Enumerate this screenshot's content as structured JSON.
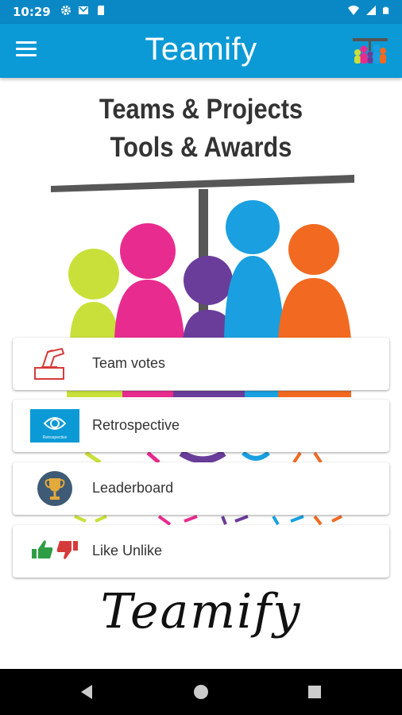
{
  "status_bar": {
    "time": "10:29",
    "icons_left": [
      "gear-icon",
      "gmail-icon",
      "sd-card-icon"
    ],
    "icons_right": [
      "wifi-icon",
      "signal-icon",
      "battery-icon"
    ]
  },
  "app_bar": {
    "title": "Teamify",
    "menu_icon": "hamburger-menu-icon",
    "logo_icon": "teamify-logo-icon"
  },
  "headline": {
    "line1": "Teams & Projects",
    "line2": "Tools & Awards"
  },
  "illustration": {
    "colors": [
      "#c9e03a",
      "#e82b8e",
      "#6a3d9a",
      "#1aa0e0",
      "#f26a21"
    ]
  },
  "menu": [
    {
      "label": "Team votes",
      "icon": "ballot-vote-icon"
    },
    {
      "label": "Retrospective",
      "icon": "retrospective-eye-icon",
      "icon_text": "Retrospective"
    },
    {
      "label": "Leaderboard",
      "icon": "trophy-icon"
    },
    {
      "label": "Like Unlike",
      "icon": "thumbs-up-down-icon"
    }
  ],
  "footer": {
    "wordmark": "Teamify"
  },
  "nav_bar": {
    "back": "back-icon",
    "home": "home-icon",
    "recents": "recents-icon"
  },
  "colors": {
    "status_bar": "#0a88c6",
    "app_bar": "#0b9ad6",
    "nav_bar": "#000000"
  }
}
